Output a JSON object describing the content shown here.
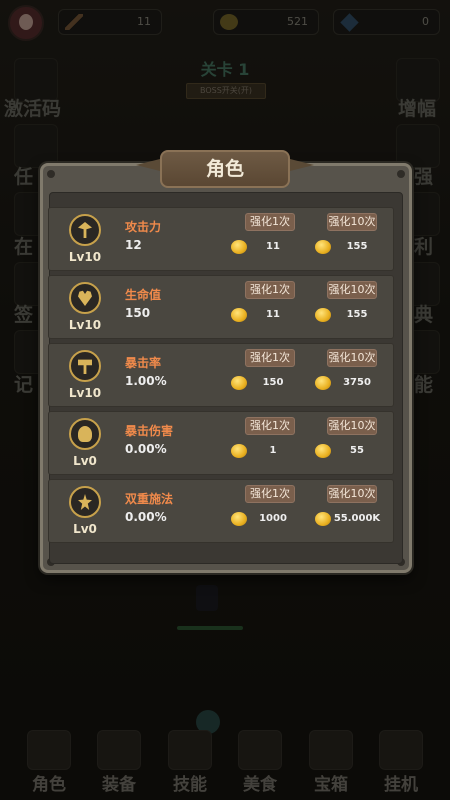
{
  "top_bar": {
    "sword_count": "11",
    "gold": "521",
    "gems": "0"
  },
  "stage": {
    "title": "关卡 1",
    "boss_switch_label": "BOSS开关(开)"
  },
  "side_buttons": {
    "left": [
      "激活码",
      "任",
      "在",
      "签",
      "记"
    ],
    "right": [
      "增幅",
      "强",
      "利",
      "典",
      "能"
    ]
  },
  "panel": {
    "title": "角色",
    "stats": [
      {
        "icon": "axe-icon",
        "level": "Lv10",
        "name": "攻击力",
        "value": "12",
        "btn1_label": "强化1次",
        "btn10_label": "强化10次",
        "cost1": "11",
        "cost10": "155"
      },
      {
        "icon": "heart-icon",
        "level": "Lv10",
        "name": "生命值",
        "value": "150",
        "btn1_label": "强化1次",
        "btn10_label": "强化10次",
        "cost1": "11",
        "cost10": "155"
      },
      {
        "icon": "hammer-icon",
        "level": "Lv10",
        "name": "暴击率",
        "value": "1.00%",
        "btn1_label": "强化1次",
        "btn10_label": "强化10次",
        "cost1": "150",
        "cost10": "3750"
      },
      {
        "icon": "skull-icon",
        "level": "Lv0",
        "name": "暴击伤害",
        "value": "0.00%",
        "btn1_label": "强化1次",
        "btn10_label": "强化10次",
        "cost1": "1",
        "cost10": "55"
      },
      {
        "icon": "starburst-icon",
        "level": "Lv0",
        "name": "双重施法",
        "value": "0.00%",
        "btn1_label": "强化1次",
        "btn10_label": "强化10次",
        "cost1": "1000",
        "cost10": "55.000K"
      }
    ]
  },
  "bottom_nav": [
    {
      "label": "角色",
      "icon": "sword-icon"
    },
    {
      "label": "装备",
      "icon": "chest-armor-icon"
    },
    {
      "label": "技能",
      "icon": "skill-scroll-icon"
    },
    {
      "label": "美食",
      "icon": "clover-icon"
    },
    {
      "label": "宝箱",
      "icon": "treasure-chest-icon"
    },
    {
      "label": "挂机",
      "icon": "afk-icon"
    }
  ]
}
